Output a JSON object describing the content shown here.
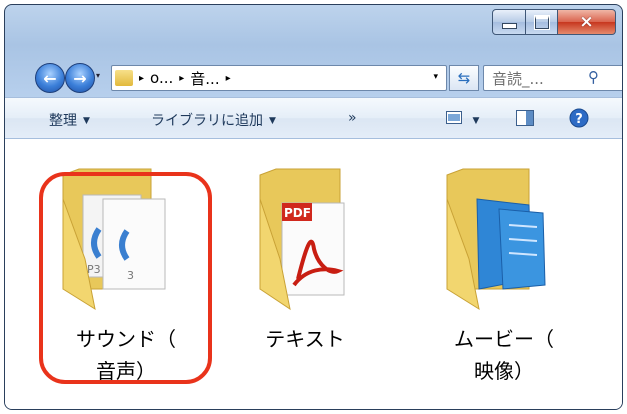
{
  "window": {
    "caption_buttons": {
      "minimize": "minimize-icon",
      "maximize": "maximize-icon",
      "close": "×"
    }
  },
  "addressbar": {
    "back_icon": "←",
    "forward_icon": "→",
    "history_icon": "▾",
    "crumbs": [
      "o...",
      "音..."
    ],
    "separator": "▸",
    "dropdown_icon": "▾",
    "refresh_icon": "⇆",
    "search_placeholder": "音読_...",
    "search_icon": "⚲"
  },
  "toolbar": {
    "organize": "整理",
    "add_to_library": "ライブラリに追加",
    "more": "»",
    "dropdown_arrow": "▼"
  },
  "items": [
    {
      "label_line1": "サウンド（",
      "label_line2": "音声）",
      "icon": "audio-folder-icon"
    },
    {
      "label_line1": "テキスト",
      "label_line2": "",
      "icon": "pdf-folder-icon"
    },
    {
      "label_line1": "ムービー（",
      "label_line2": "映像）",
      "icon": "video-folder-icon"
    }
  ],
  "highlight_color": "#e9331b"
}
